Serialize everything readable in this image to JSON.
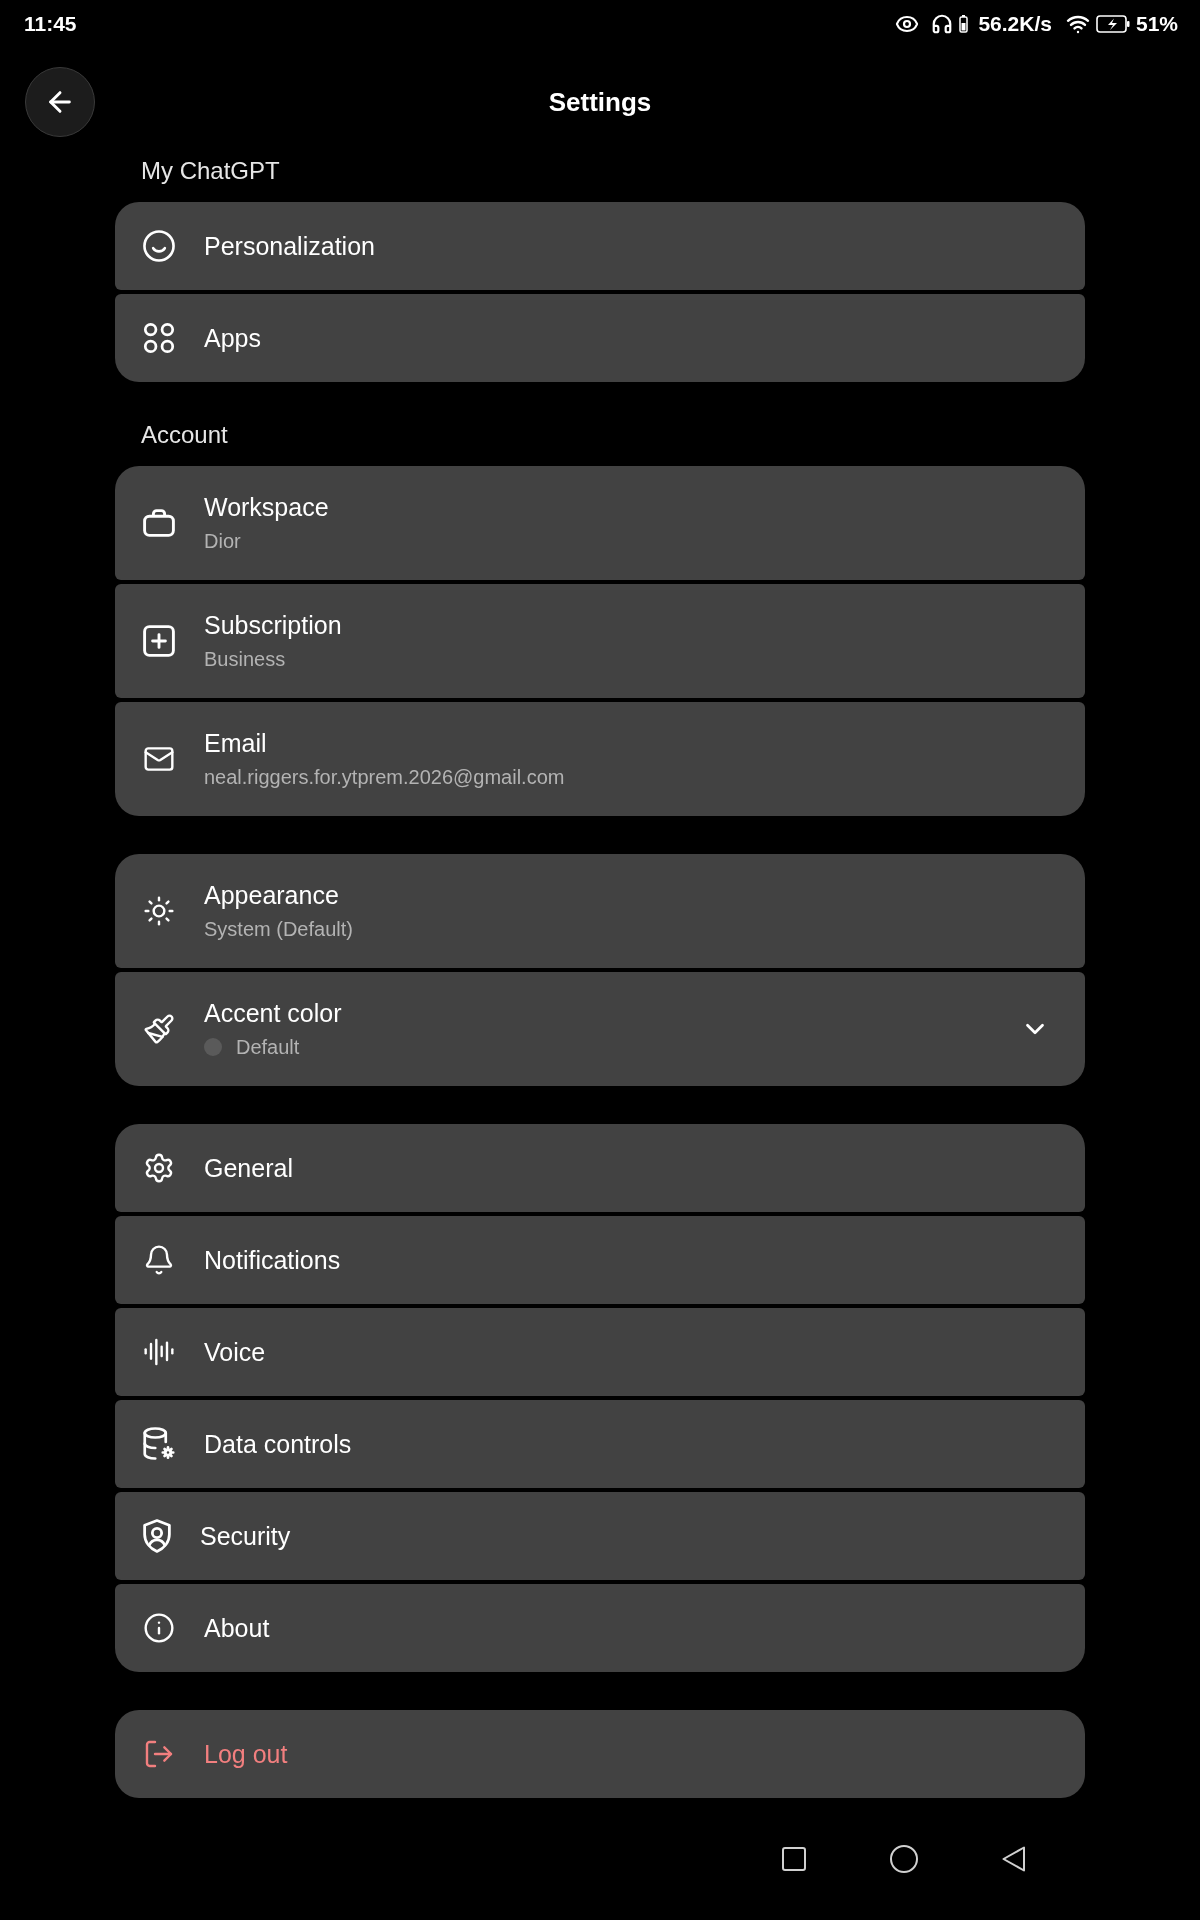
{
  "status_bar": {
    "time": "11:45",
    "network_speed": "56.2K/s",
    "battery": "51%"
  },
  "header": {
    "title": "Settings"
  },
  "sections": [
    {
      "heading": "My ChatGPT",
      "items": [
        {
          "kind": "link",
          "label": "Personalization"
        },
        {
          "kind": "link",
          "label": "Apps"
        }
      ]
    },
    {
      "heading": "Account",
      "items": [
        {
          "kind": "link",
          "label": "Workspace",
          "value": "Dior"
        },
        {
          "kind": "link",
          "label": "Subscription",
          "value": "Business"
        },
        {
          "kind": "link",
          "label": "Email",
          "value": "neal.riggers.for.ytprem.2026@gmail.com"
        }
      ]
    },
    {
      "items": [
        {
          "kind": "link",
          "label": "Appearance",
          "value": "System (Default)"
        },
        {
          "kind": "dropdown",
          "label": "Accent color",
          "value": "Default",
          "color": "#5a5a5a",
          "expanded": false
        }
      ]
    },
    {
      "items": [
        {
          "kind": "link",
          "label": "General"
        },
        {
          "kind": "link",
          "label": "Notifications"
        },
        {
          "kind": "link",
          "label": "Voice"
        },
        {
          "kind": "link",
          "label": "Data controls"
        },
        {
          "kind": "link",
          "label": "Security"
        },
        {
          "kind": "link",
          "label": "About"
        }
      ]
    },
    {
      "items": [
        {
          "kind": "destructive",
          "label": "Log out"
        }
      ]
    }
  ]
}
